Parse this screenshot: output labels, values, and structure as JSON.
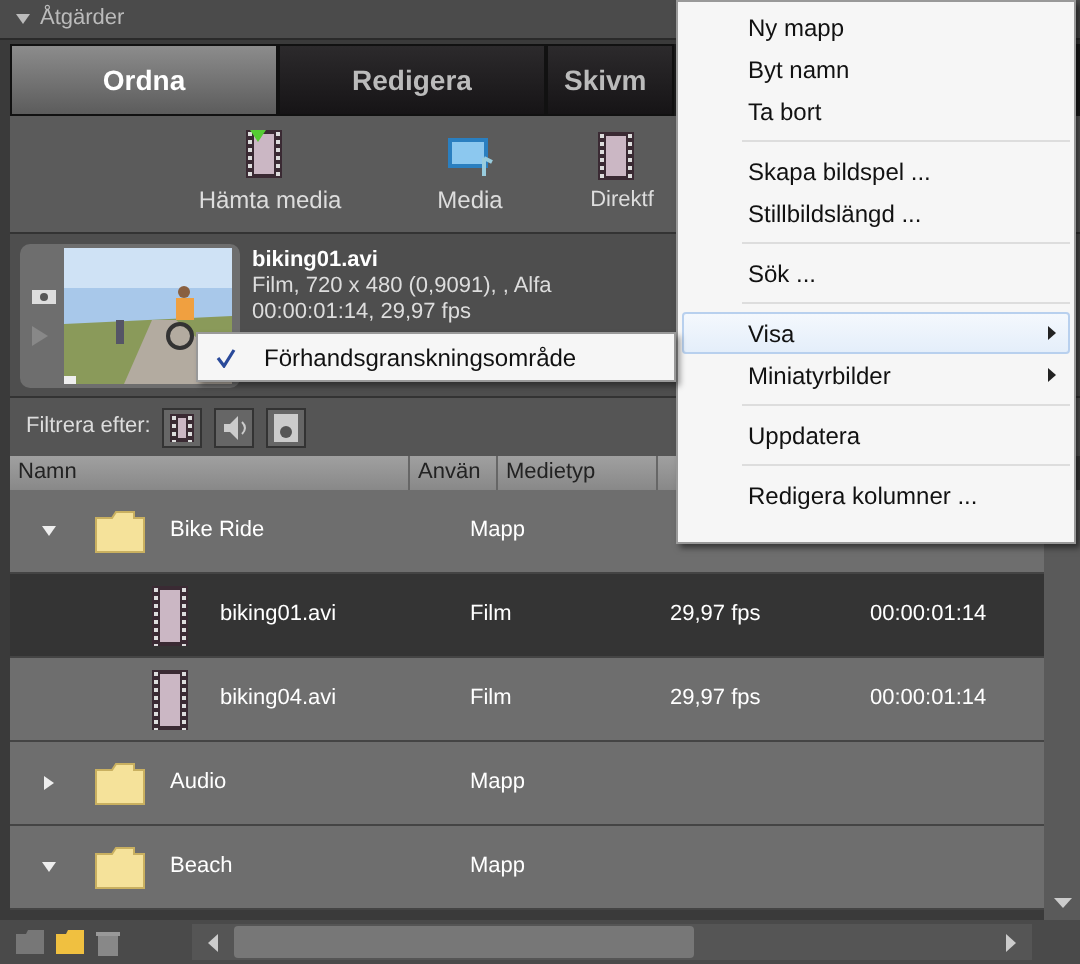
{
  "panel_title": "Åtgärder",
  "tabs": [
    {
      "label": "Ordna",
      "selected": true
    },
    {
      "label": "Redigera",
      "selected": false
    },
    {
      "label": "Skivm",
      "selected": false
    }
  ],
  "toolbar": [
    {
      "label": "Hämta media",
      "kind": "import"
    },
    {
      "label": "Media",
      "kind": "media"
    },
    {
      "label": "Direktf",
      "kind": "instant"
    }
  ],
  "preview": {
    "filename": "biking01.avi",
    "details": [
      "Film, 720 x 480 (0,9091), , Alfa",
      "00:00:01:14, 29,97 fps"
    ]
  },
  "filter": {
    "label": "Filtrera efter:"
  },
  "columns": [
    "Namn",
    "Använ",
    "Medietyp"
  ],
  "rows": [
    {
      "name": "Bike Ride",
      "kind": "folder",
      "type": "Mapp",
      "expanded": true,
      "selected": false,
      "children": [
        {
          "name": "biking01.avi",
          "kind": "film",
          "type": "Film",
          "rate": "29,97 fps",
          "duration": "00:00:01:14",
          "selected": true
        },
        {
          "name": "biking04.avi",
          "kind": "film",
          "type": "Film",
          "rate": "29,97 fps",
          "duration": "00:00:01:14",
          "selected": false
        }
      ]
    },
    {
      "name": "Audio",
      "kind": "folder",
      "type": "Mapp",
      "expanded": false,
      "selected": false
    },
    {
      "name": "Beach",
      "kind": "folder",
      "type": "Mapp",
      "expanded": true,
      "selected": false
    }
  ],
  "context_menu": [
    [
      {
        "label": "Ny mapp",
        "submenu": false,
        "selected": false
      },
      {
        "label": "Byt namn",
        "submenu": false,
        "selected": false
      },
      {
        "label": "Ta bort",
        "submenu": false,
        "selected": false
      }
    ],
    [
      {
        "label": "Skapa bildspel ...",
        "submenu": false,
        "selected": false
      },
      {
        "label": "Stillbildslängd ...",
        "submenu": false,
        "selected": false
      }
    ],
    [
      {
        "label": "Sök ...",
        "submenu": false,
        "selected": false
      }
    ],
    [
      {
        "label": "Visa",
        "submenu": true,
        "selected": true
      },
      {
        "label": "Miniatyrbilder",
        "submenu": true,
        "selected": false
      }
    ],
    [
      {
        "label": "Uppdatera",
        "submenu": false,
        "selected": false
      }
    ],
    [
      {
        "label": "Redigera kolumner ...",
        "submenu": false,
        "selected": false
      }
    ]
  ],
  "submenu": [
    {
      "label": "Förhandsgranskningsområde",
      "checked": true
    }
  ]
}
